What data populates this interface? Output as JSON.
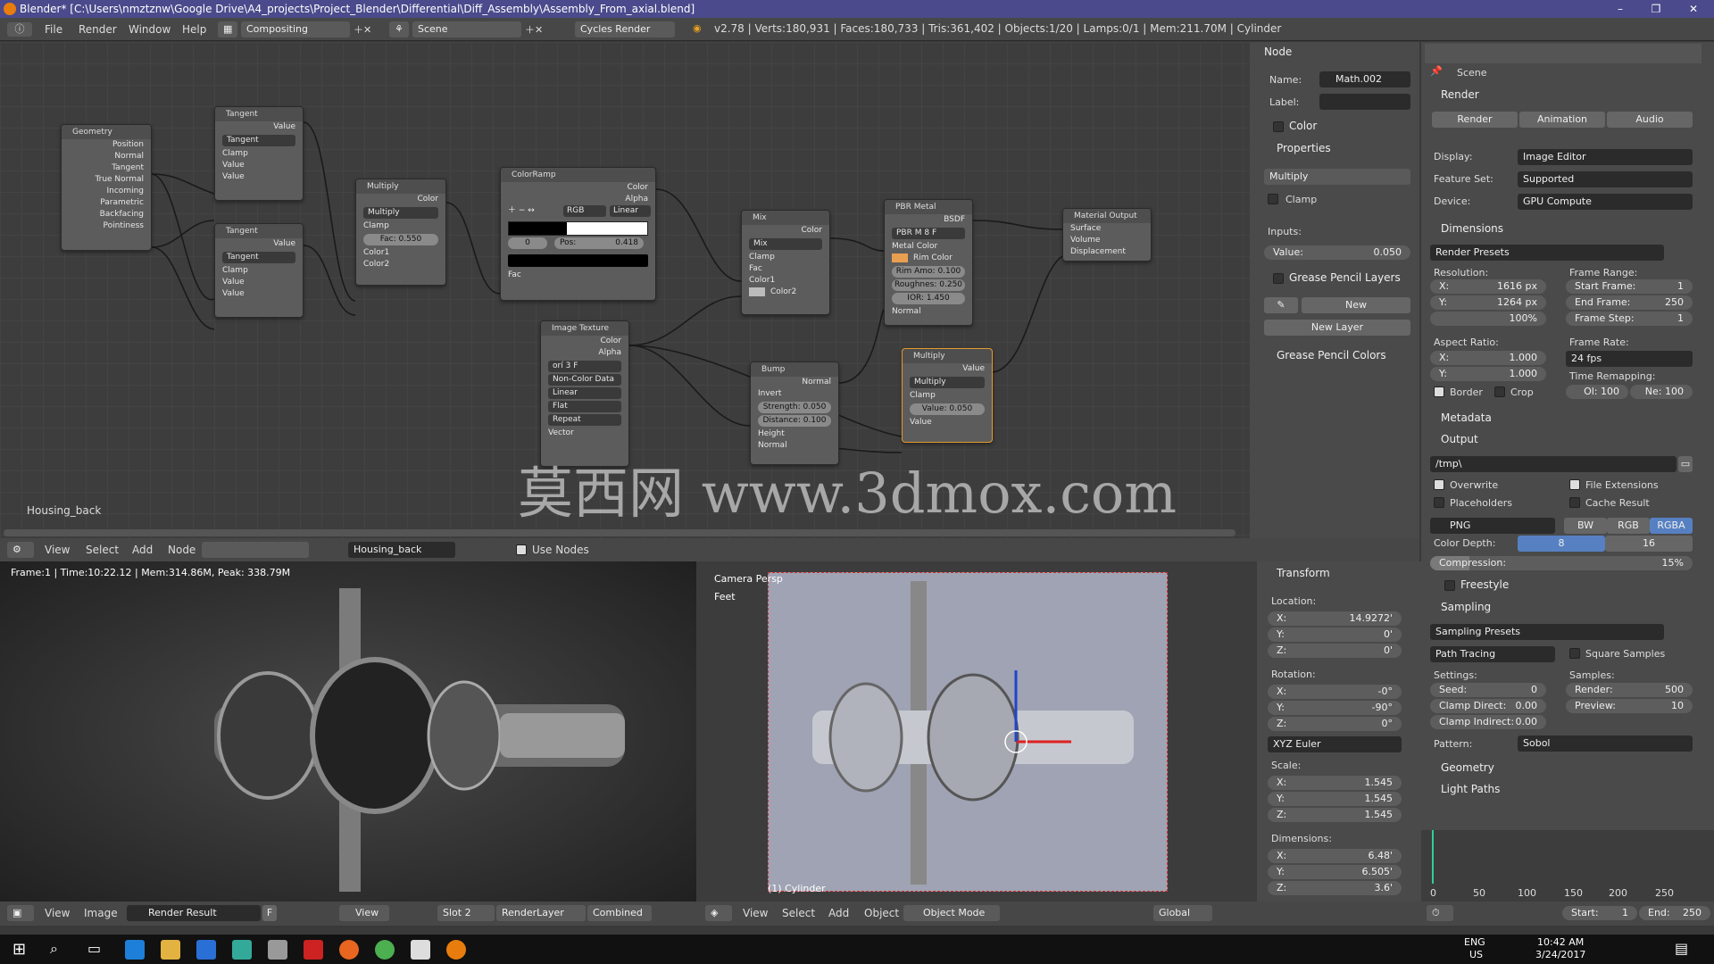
{
  "title": "Blender* [C:\\Users\\nmztznw\\Google Drive\\A4_projects\\Project_Blender\\Differential\\Diff_Assembly\\Assembly_From_axial.blend]",
  "top_menu": [
    "File",
    "Render",
    "Window",
    "Help"
  ],
  "layout": "Compositing",
  "scene": "Scene",
  "engine": "Cycles Render",
  "stats": "v2.78 | Verts:180,931 | Faces:180,733 | Tris:361,402 | Objects:1/20 | Lamps:0/1 | Mem:211.70M | Cylinder",
  "watermark": "莫西网 www.3dmox.com",
  "node_editor": {
    "material_label": "Housing_back",
    "header_menu": [
      "View",
      "Select",
      "Add",
      "Node"
    ],
    "material": "Housing_back",
    "use_nodes": "Use Nodes",
    "nodes": {
      "geometry": {
        "title": "Geometry",
        "outputs": [
          "Position",
          "Normal",
          "Tangent",
          "True Normal",
          "Incoming",
          "Parametric",
          "Backfacing",
          "Pointiness"
        ]
      },
      "tangent1": {
        "title": "Tangent",
        "out": "Value",
        "op": "Tangent",
        "clamp": "Clamp",
        "in1": "Value",
        "in2": "Value"
      },
      "tangent2": {
        "title": "Tangent",
        "out": "Value",
        "op": "Tangent",
        "clamp": "Clamp",
        "in1": "Value",
        "in2": "Value"
      },
      "multiply1": {
        "title": "Multiply",
        "out": "Color",
        "op": "Multiply",
        "clamp": "Clamp",
        "fac_label": "Fac:",
        "fac": "0.550",
        "in1": "Color1",
        "in2": "Color2"
      },
      "colorramp": {
        "title": "ColorRamp",
        "out1": "Color",
        "out2": "Alpha",
        "mode": "RGB",
        "interp": "Linear",
        "idx": "0",
        "pos_label": "Pos:",
        "pos": "0.418",
        "in": "Fac"
      },
      "mix": {
        "title": "Mix",
        "out": "Color",
        "op": "Mix",
        "clamp": "Clamp",
        "in0": "Fac",
        "in1": "Color1",
        "in2": "Color2"
      },
      "pbr": {
        "title": "PBR Metal",
        "out": "BSDF",
        "group": "PBR M",
        "users": "8",
        "fake": "F",
        "in1": "Metal Color",
        "in2": "Rim Color",
        "rim": "Rim Amo: 0.100",
        "rough": "Roughnes: 0.250",
        "ior": "IOR:",
        "ior_v": "1.450",
        "in3": "Normal"
      },
      "matout": {
        "title": "Material Output",
        "in": [
          "Surface",
          "Volume",
          "Displacement"
        ]
      },
      "imgtex": {
        "title": "Image Texture",
        "out1": "Color",
        "out2": "Alpha",
        "img": "orí",
        "users": "3",
        "fake": "F",
        "cs": "Non-Color Data",
        "interp": "Linear",
        "proj": "Flat",
        "ext": "Repeat",
        "in": "Vector"
      },
      "bump": {
        "title": "Bump",
        "out": "Normal",
        "invert": "Invert",
        "strength": "Strength: 0.050",
        "distance": "Distance: 0.100",
        "in1": "Height",
        "in2": "Normal"
      },
      "multiply2": {
        "title": "Multiply",
        "out": "Value",
        "op": "Multiply",
        "clamp": "Clamp",
        "val": "Value:",
        "val_v": "0.050",
        "in": "Value"
      }
    }
  },
  "node_sidebar": {
    "node_header": "Node",
    "name_label": "Name:",
    "name": "Math.002",
    "label_label": "Label:",
    "color": "Color",
    "properties": "Properties",
    "op": "Multiply",
    "clamp": "Clamp",
    "inputs": "Inputs:",
    "value_label": "Value:",
    "value": "0.050",
    "gp_layers": "Grease Pencil Layers",
    "new": "New",
    "new_layer": "New Layer",
    "gp_colors": "Grease Pencil Colors"
  },
  "properties": {
    "scene": "Scene",
    "render_header": "Render",
    "tabs": [
      "Render",
      "Animation",
      "Audio"
    ],
    "display_label": "Display:",
    "display": "Image Editor",
    "feature_label": "Feature Set:",
    "feature": "Supported",
    "device_label": "Device:",
    "device": "GPU Compute",
    "dimensions": "Dimensions",
    "render_presets": "Render Presets",
    "resolution": "Resolution:",
    "res_x": "1616 px",
    "res_y": "1264 px",
    "res_pct": "100%",
    "frame_range": "Frame Range:",
    "start": "Start Frame:",
    "start_v": "1",
    "end": "End Frame:",
    "end_v": "250",
    "step": "Frame Step:",
    "step_v": "1",
    "aspect": "Aspect Ratio:",
    "asp_x": "1.000",
    "asp_y": "1.000",
    "frame_rate": "Frame Rate:",
    "fps": "24 fps",
    "time_remap": "Time Remapping:",
    "old": "Ol: 100",
    "new_v": "Ne: 100",
    "border": "Border",
    "crop": "Crop",
    "metadata": "Metadata",
    "output": "Output",
    "path": "/tmp\\",
    "overwrite": "Overwrite",
    "file_ext": "File Extensions",
    "placeholders": "Placeholders",
    "cache": "Cache Result",
    "format": "PNG",
    "bw": "BW",
    "rgb": "RGB",
    "rgba": "RGBA",
    "color_depth": "Color Depth:",
    "d8": "8",
    "d16": "16",
    "compression": "Compression:",
    "compression_v": "15%",
    "freestyle": "Freestyle",
    "sampling": "Sampling",
    "sampling_presets": "Sampling Presets",
    "integrator": "Path Tracing",
    "square": "Square Samples",
    "settings": "Settings:",
    "seed": "Seed:",
    "seed_v": "0",
    "clamp_direct": "Clamp Direct:",
    "clamp_direct_v": "0.00",
    "clamp_indirect": "Clamp Indirect:",
    "clamp_indirect_v": "0.00",
    "samples": "Samples:",
    "render": "Render:",
    "render_v": "500",
    "preview": "Preview:",
    "preview_v": "10",
    "pattern": "Pattern:",
    "pattern_v": "Sobol",
    "geometry": "Geometry",
    "light_paths": "Light Paths"
  },
  "image_editor": {
    "info": "Frame:1 | Time:10:22.12 | Mem:314.86M, Peak: 338.79M",
    "header_menu": [
      "View",
      "Image"
    ],
    "image": "Render Result",
    "fake": "F",
    "view": "View",
    "slot": "Slot 2",
    "layer": "RenderLayer",
    "pass": "Combined"
  },
  "viewport": {
    "camera": "Camera Persp",
    "units": "Feet",
    "object": "(1) Cylinder",
    "header_menu": [
      "View",
      "Select",
      "Add",
      "Object"
    ],
    "mode": "Object Mode",
    "orientation": "Global"
  },
  "transform": {
    "header": "Transform",
    "location": "Location:",
    "loc": [
      "X:",
      "14.9272'",
      "Y:",
      "0'",
      "Z:",
      "0'"
    ],
    "rotation": "Rotation:",
    "rot": [
      "X:",
      "-0°",
      "Y:",
      "-90°",
      "Z:",
      "0°"
    ],
    "euler": "XYZ Euler",
    "scale": "Scale:",
    "scl": [
      "X:",
      "1.545",
      "Y:",
      "1.545",
      "Z:",
      "1.545"
    ],
    "dimensions": "Dimensions:",
    "dim": [
      "X:",
      "6.48'",
      "Y:",
      "6.505'",
      "Z:",
      "3.6'"
    ]
  },
  "timeline": {
    "ticks": [
      "0",
      "50",
      "100",
      "150",
      "200",
      "250"
    ],
    "start": "Start:",
    "start_v": "1",
    "end": "End:",
    "end_v": "250"
  },
  "taskbar": {
    "lang": "ENG",
    "region": "US",
    "time": "10:42 AM",
    "date": "3/24/2017"
  }
}
